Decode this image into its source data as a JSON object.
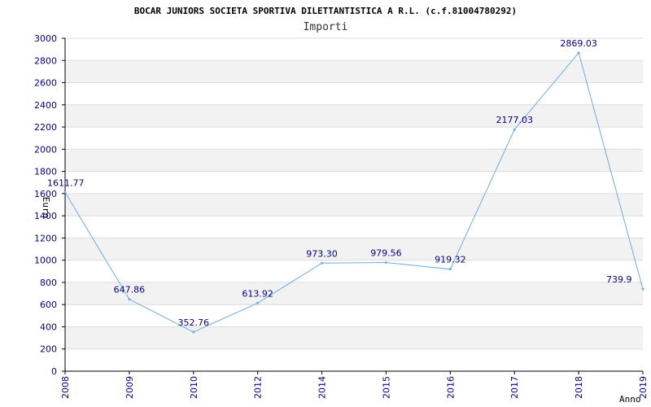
{
  "chart_data": {
    "type": "line",
    "title": "BOCAR JUNIORS SOCIETA SPORTIVA DILETTANTISTICA A R.L. (c.f.81004780292)",
    "subtitle": "Importi",
    "xlabel": "Anno",
    "ylabel": "Euro",
    "x": [
      "2008",
      "2009",
      "2010",
      "2012",
      "2014",
      "2015",
      "2016",
      "2017",
      "2018",
      "2019"
    ],
    "series": [
      {
        "values": [
          1611.77,
          647.86,
          352.76,
          613.92,
          973.3,
          979.56,
          919.32,
          2177.03,
          2869.03,
          739.9
        ],
        "labels": [
          "1611.77",
          "647.86",
          "352.76",
          "613.92",
          "973.30",
          "979.56",
          "919.32",
          "2177.03",
          "2869.03",
          "739.9"
        ]
      }
    ],
    "ylim": [
      0,
      3000
    ],
    "yticks": [
      0,
      200,
      400,
      600,
      800,
      1000,
      1200,
      1400,
      1600,
      1800,
      2000,
      2200,
      2400,
      2600,
      2800,
      3000
    ],
    "grid": true,
    "colors": {
      "line": "#6aaee8",
      "band": "#f2f2f2",
      "grid": "#dcdcdc",
      "axis": "#000000",
      "tick_text": "#00008b"
    }
  }
}
